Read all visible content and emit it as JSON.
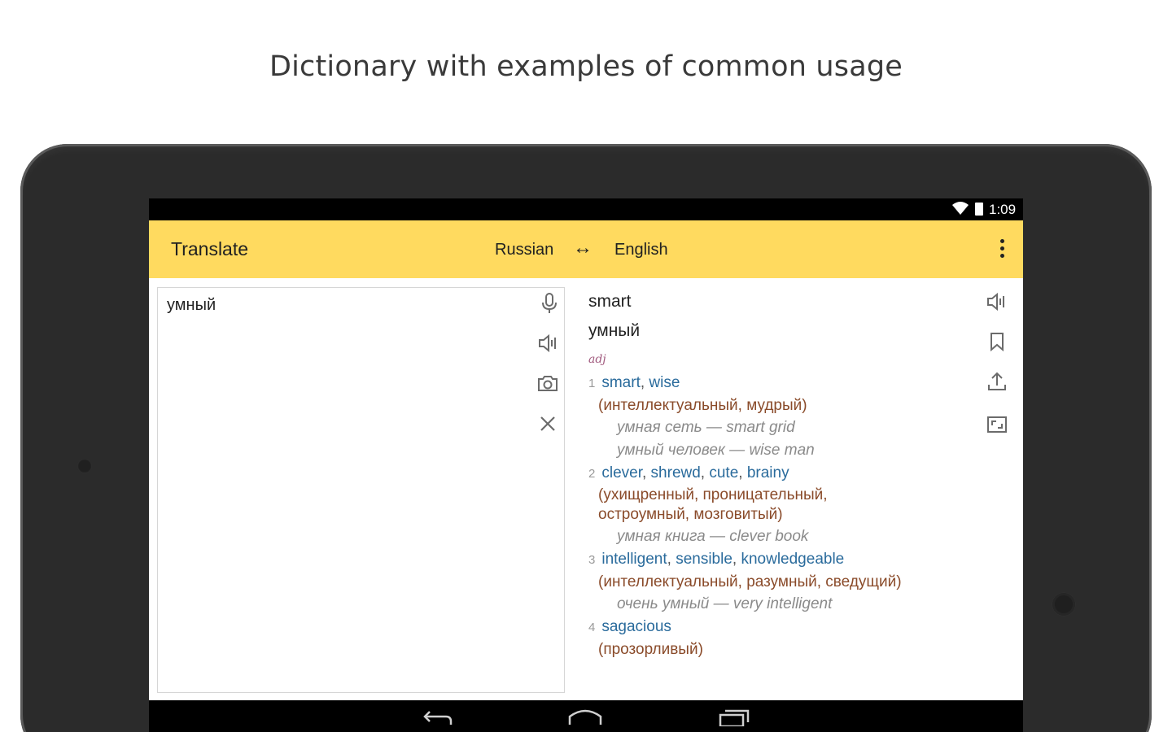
{
  "headline": "Dictionary with examples of common usage",
  "status_bar": {
    "time": "1:09",
    "icons": [
      "wifi-icon",
      "battery-icon"
    ]
  },
  "toolbar": {
    "title": "Translate",
    "source_language": "Russian",
    "swap_symbol": "↔",
    "target_language": "English",
    "menu_icon": "more-vert-icon",
    "background": "#ffda5f"
  },
  "input": {
    "text": "умный",
    "icons": [
      "microphone-icon",
      "speaker-icon",
      "camera-icon",
      "clear-icon"
    ]
  },
  "result": {
    "translation": "smart",
    "source_word": "умный",
    "part_of_speech": "adj",
    "icons": [
      "speaker-icon",
      "bookmark-icon",
      "share-icon",
      "fullscreen-icon"
    ],
    "senses": [
      {
        "number": "1",
        "translations": [
          "smart",
          "wise"
        ],
        "gloss": "(интеллектуальный, мудрый)",
        "examples": [
          "умная сеть — smart grid",
          "умный человек — wise man"
        ]
      },
      {
        "number": "2",
        "translations": [
          "clever",
          "shrewd",
          "cute",
          "brainy"
        ],
        "gloss": "(ухищренный, проницательный, остроумный, мозговитый)",
        "examples": [
          "умная книга — clever book"
        ]
      },
      {
        "number": "3",
        "translations": [
          "intelligent",
          "sensible",
          "knowledgeable"
        ],
        "gloss": "(интеллектуальный, разумный, сведущий)",
        "examples": [
          "очень умный — very intelligent"
        ]
      },
      {
        "number": "4",
        "translations": [
          "sagacious"
        ],
        "gloss": "(прозорливый)",
        "examples": []
      }
    ]
  },
  "navbar": {
    "icons": [
      "back-icon",
      "home-icon",
      "recents-icon"
    ]
  }
}
